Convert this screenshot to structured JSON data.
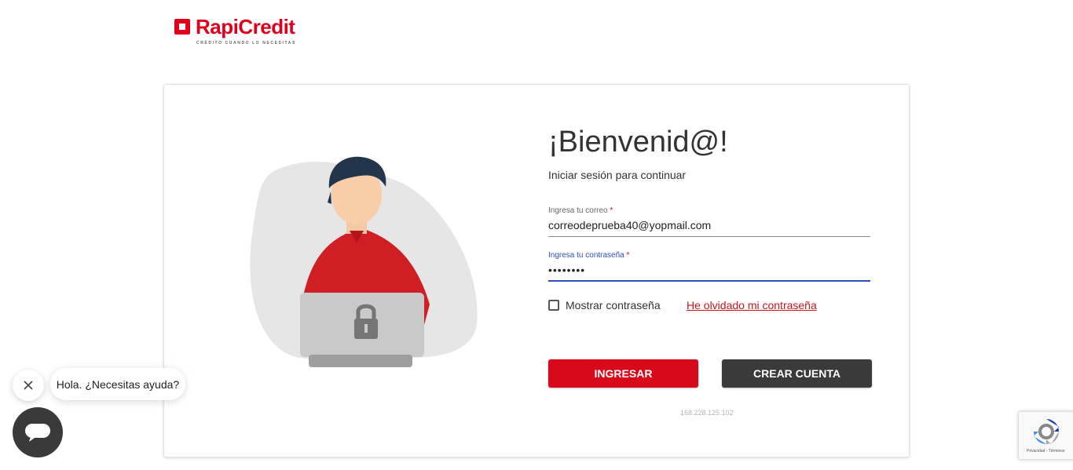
{
  "brand": {
    "name": "RapiCredit",
    "tagline": "CRÉDITO CUANDO LO NECESITAS",
    "color": "#e0001b"
  },
  "login": {
    "title": "¡Bienvenid@!",
    "subtitle": "Iniciar sesión para continuar",
    "email": {
      "label": "Ingresa tu correo",
      "required_mark": "*",
      "value": "correodeprueba40@yopmail.com"
    },
    "password": {
      "label": "Ingresa tu contraseña",
      "required_mark": "*",
      "value": "••••••••"
    },
    "show_password": {
      "label": "Mostrar contraseña",
      "checked": false
    },
    "forgot_link": "He olvidado mi contraseña",
    "login_button": "INGRESAR",
    "create_button": "CREAR CUENTA",
    "ip": "168.228.125.102"
  },
  "chat": {
    "message": "Hola. ¿Necesitas ayuda?",
    "close_icon": "close-icon",
    "launcher_icon": "chat-icon"
  },
  "recaptcha": {
    "footer": "Privacidad - Términos"
  },
  "colors": {
    "primary": "#d9091c",
    "secondary": "#3a3a3a",
    "focus": "#2f4fb5"
  }
}
